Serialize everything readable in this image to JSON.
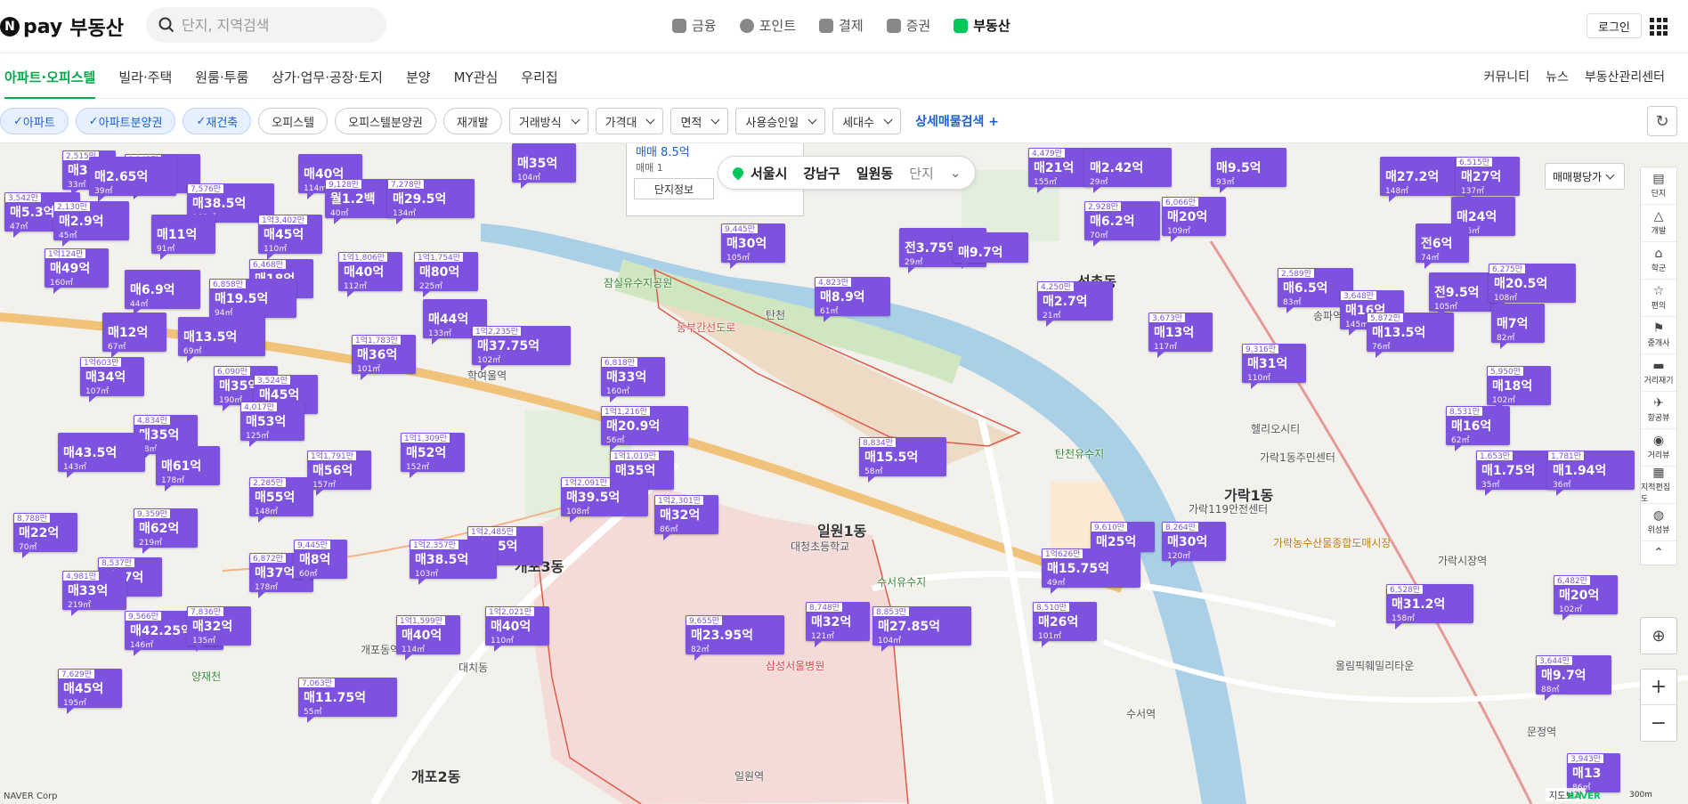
{
  "header": {
    "logo_pay": "pay",
    "logo_service": "부동산",
    "search_placeholder": "단지, 지역검색",
    "gnb": [
      {
        "label": "금융",
        "active": false
      },
      {
        "label": "포인트",
        "active": false
      },
      {
        "label": "결제",
        "active": false
      },
      {
        "label": "증권",
        "active": false
      },
      {
        "label": "부동산",
        "active": true
      }
    ],
    "login_label": "로그인"
  },
  "subnav": {
    "left": [
      "아파트·오피스텔",
      "빌라·주택",
      "원룸·투룸",
      "상가·업무·공장·토지",
      "분양",
      "MY관심",
      "우리집"
    ],
    "right": [
      "커뮤니티",
      "뉴스",
      "부동산관리센터"
    ]
  },
  "filters": {
    "selected_chips": [
      "아파트",
      "아파트분양권",
      "재건축"
    ],
    "chips": [
      "오피스텔",
      "오피스텔분양권",
      "재개발"
    ],
    "dropdowns": [
      "거래방식",
      "가격대",
      "면적",
      "사용승인일",
      "세대수"
    ],
    "advanced_label": "상세매물검색 +"
  },
  "map": {
    "breadcrumb": {
      "city": "서울시",
      "district": "강남구",
      "dong": "일원동",
      "type": "단지"
    },
    "popup": {
      "title": "매매 8.5억",
      "sub": "매매 1",
      "tab": "단지정보"
    },
    "unit_select": "매매평당가",
    "tools": [
      {
        "label": "단지",
        "glyph": "▤"
      },
      {
        "label": "개발",
        "glyph": "△"
      },
      {
        "label": "학군",
        "glyph": "⌂"
      },
      {
        "label": "편의",
        "glyph": "☆"
      },
      {
        "label": "중개사",
        "glyph": "⚑"
      },
      {
        "label": "거리재기",
        "glyph": "▬"
      },
      {
        "label": "항공뷰",
        "glyph": "✈"
      },
      {
        "label": "거리뷰",
        "glyph": "◉"
      },
      {
        "label": "지적편집도",
        "glyph": "▦"
      },
      {
        "label": "위성뷰",
        "glyph": "◍"
      }
    ],
    "copyright": "NAVER Corp",
    "scale_label": "지도보기",
    "naver_tag": "NAVER",
    "scale_bar": "300m",
    "places": [
      {
        "name": "석촌동",
        "big": true
      },
      {
        "name": "가락1동",
        "big": true
      },
      {
        "name": "일원1동",
        "big": true
      },
      {
        "name": "개포3동",
        "big": true
      },
      {
        "name": "개포2동",
        "big": true
      },
      {
        "name": "탄천",
        "big": false
      },
      {
        "name": "학여울역",
        "big": false
      },
      {
        "name": "송파역",
        "big": false
      },
      {
        "name": "가락시장역",
        "big": false
      },
      {
        "name": "수서역",
        "big": false
      },
      {
        "name": "문정역",
        "big": false
      },
      {
        "name": "일원역",
        "big": false
      },
      {
        "name": "개포동역",
        "big": false
      },
      {
        "name": "양재천",
        "big": false
      },
      {
        "name": "삼성서울병원",
        "big": false
      },
      {
        "name": "대청초등학교",
        "big": false
      },
      {
        "name": "수서유수지",
        "big": false
      },
      {
        "name": "탄천유수지",
        "big": false
      },
      {
        "name": "동부간선도로",
        "big": false
      },
      {
        "name": "잠실유수지공원",
        "big": false
      },
      {
        "name": "헬리오시티",
        "big": false
      },
      {
        "name": "가락1동주민센터",
        "big": false
      },
      {
        "name": "가락119안전센터",
        "big": false
      },
      {
        "name": "올림픽훼밀리타운",
        "big": false
      },
      {
        "name": "대치동",
        "big": false
      },
      {
        "name": "가락농수산물종합도매시장",
        "big": false
      }
    ],
    "markers": [
      {
        "cnt": "2,515만",
        "price": "매3",
        "area": "33㎡"
      },
      {
        "cnt": "3,165만",
        "price": "매4.5억",
        "area": "47㎡"
      },
      {
        "cnt": "",
        "price": "매40억",
        "area": "114㎡"
      },
      {
        "cnt": "",
        "price": "매35억",
        "area": "104㎡"
      },
      {
        "cnt": "",
        "price": "매2.65억",
        "area": "39㎡"
      },
      {
        "cnt": "3,542만",
        "price": "매5.3억",
        "area": "47㎡"
      },
      {
        "cnt": "9,128만",
        "price": "월1.2백",
        "area": "40㎡"
      },
      {
        "cnt": "7,278만",
        "price": "매29.5억",
        "area": "134㎡"
      },
      {
        "cnt": "7,576만",
        "price": "매38.5억",
        "area": "168㎡"
      },
      {
        "cnt": "2,130만",
        "price": "매2.9억",
        "area": "45㎡"
      },
      {
        "cnt": "",
        "price": "매11억",
        "area": "91㎡"
      },
      {
        "cnt": "1억3,402만",
        "price": "매45억",
        "area": "110㎡"
      },
      {
        "cnt": "1억124만",
        "price": "매49억",
        "area": "160㎡"
      },
      {
        "cnt": "6,468만",
        "price": "매18억",
        "area": "91㎡"
      },
      {
        "cnt": "1억1,806만",
        "price": "매40억",
        "area": "112㎡"
      },
      {
        "cnt": "1억1,754만",
        "price": "매80억",
        "area": "225㎡"
      },
      {
        "cnt": "",
        "price": "매6.9억",
        "area": "44㎡"
      },
      {
        "cnt": "6,858만",
        "price": "매19.5억",
        "area": "94㎡"
      },
      {
        "cnt": "",
        "price": "매44억",
        "area": "133㎡"
      },
      {
        "cnt": "",
        "price": "매12억",
        "area": "67㎡"
      },
      {
        "cnt": "",
        "price": "매13.5억",
        "area": "69㎡"
      },
      {
        "cnt": "1억2,235만",
        "price": "매37.75억",
        "area": "102㎡"
      },
      {
        "cnt": "1억1,783만",
        "price": "매36억",
        "area": "101㎡"
      },
      {
        "cnt": "1억603만",
        "price": "매34억",
        "area": "107㎡"
      },
      {
        "cnt": "6,090만",
        "price": "매35억",
        "area": "190㎡"
      },
      {
        "cnt": "3,524만",
        "price": "매45억",
        "area": "127㎡"
      },
      {
        "cnt": "4,834만",
        "price": "매35억",
        "area": "78㎡"
      },
      {
        "cnt": "4,017만",
        "price": "매53억",
        "area": "125㎡"
      },
      {
        "cnt": "",
        "price": "매43.5억",
        "area": "143㎡"
      },
      {
        "cnt": "",
        "price": "매61억",
        "area": "178㎡"
      },
      {
        "cnt": "1억1,309만",
        "price": "매52억",
        "area": "152㎡"
      },
      {
        "cnt": "1억1,791만",
        "price": "매56억",
        "area": "157㎡"
      },
      {
        "cnt": "2,285만",
        "price": "매55억",
        "area": "148㎡"
      },
      {
        "cnt": "6,818만",
        "price": "매33억",
        "area": "160㎡"
      },
      {
        "cnt": "1억1,216만",
        "price": "매20.9억",
        "area": "56㎡"
      },
      {
        "cnt": "1억1,019만",
        "price": "매35억",
        "area": "105㎡"
      },
      {
        "cnt": "1억2,091만",
        "price": "매39.5억",
        "area": "108㎡"
      },
      {
        "cnt": "1억2,301만",
        "price": "매32억",
        "area": "86㎡"
      },
      {
        "cnt": "1억2,485만",
        "price": "매5.5억",
        "area": "39㎡"
      },
      {
        "cnt": "8,788만",
        "price": "매22억",
        "area": "70㎡"
      },
      {
        "cnt": "9,359만",
        "price": "매62억",
        "area": "219㎡"
      },
      {
        "cnt": "8,537만",
        "price": "매47억",
        "area": "182㎡"
      },
      {
        "cnt": "4,981만",
        "price": "매33억",
        "area": "219㎡"
      },
      {
        "cnt": "6,872만",
        "price": "매37억",
        "area": "178㎡"
      },
      {
        "cnt": "9,445만",
        "price": "매8억",
        "area": "60㎡"
      },
      {
        "cnt": "1억2,357만",
        "price": "매38.5억",
        "area": "103㎡"
      },
      {
        "cnt": "9,566만",
        "price": "매42.25억",
        "area": "146㎡"
      },
      {
        "cnt": "7,836만",
        "price": "매32억",
        "area": "135㎡"
      },
      {
        "cnt": "1억1,599만",
        "price": "매40억",
        "area": "114㎡"
      },
      {
        "cnt": "1억2,021만",
        "price": "매40억",
        "area": "110㎡"
      },
      {
        "cnt": "7,629만",
        "price": "매45억",
        "area": "195㎡"
      },
      {
        "cnt": "7,063만",
        "price": "매11.75억",
        "area": "55㎡"
      },
      {
        "cnt": "9,655만",
        "price": "매23.95억",
        "area": "82㎡"
      },
      {
        "cnt": "8,748만",
        "price": "매32억",
        "area": "121㎡"
      },
      {
        "cnt": "8,853만",
        "price": "매27.85억",
        "area": "104㎡"
      },
      {
        "cnt": "8,834만",
        "price": "매15.5억",
        "area": "58㎡"
      },
      {
        "cnt": "9,445만",
        "price": "매30억",
        "area": "105㎡"
      },
      {
        "cnt": "4,823만",
        "price": "매8.9억",
        "area": "61㎡"
      },
      {
        "cnt": "",
        "price": "전3.75억",
        "area": "29㎡"
      },
      {
        "cnt": "",
        "price": "매9.7억",
        "area": ""
      },
      {
        "cnt": "4,250만",
        "price": "매2.7억",
        "area": "21㎡"
      },
      {
        "cnt": "4,479만",
        "price": "매21억",
        "area": "155㎡"
      },
      {
        "cnt": "",
        "price": "매2.42억",
        "area": "29㎡"
      },
      {
        "cnt": "2,928만",
        "price": "매6.2억",
        "area": "70㎡"
      },
      {
        "cnt": "6,066만",
        "price": "매20억",
        "area": "109㎡"
      },
      {
        "cnt": "",
        "price": "매9.5억",
        "area": "93㎡"
      },
      {
        "cnt": "3,673만",
        "price": "매13억",
        "area": "117㎡"
      },
      {
        "cnt": "9,316만",
        "price": "매31억",
        "area": "110㎡"
      },
      {
        "cnt": "9,610만",
        "price": "매25억",
        "area": ""
      },
      {
        "cnt": "8,264만",
        "price": "매30억",
        "area": "120㎡"
      },
      {
        "cnt": "1억626만",
        "price": "매15.75억",
        "area": "49㎡"
      },
      {
        "cnt": "8,510만",
        "price": "매26억",
        "area": "101㎡"
      },
      {
        "cnt": "2,589만",
        "price": "매6.5억",
        "area": "83㎡"
      },
      {
        "cnt": "3,648만",
        "price": "매16억",
        "area": "145㎡"
      },
      {
        "cnt": "5,872만",
        "price": "매13.5억",
        "area": "76㎡"
      },
      {
        "cnt": "",
        "price": "매27.2억",
        "area": "148㎡"
      },
      {
        "cnt": "6,515만",
        "price": "매27억",
        "area": "137㎡"
      },
      {
        "cnt": "",
        "price": "매24억",
        "area": "105㎡"
      },
      {
        "cnt": "",
        "price": "전6억",
        "area": "74㎡"
      },
      {
        "cnt": "",
        "price": "전9.5억",
        "area": "105㎡"
      },
      {
        "cnt": "6,275만",
        "price": "매20.5억",
        "area": "108㎡"
      },
      {
        "cnt": "",
        "price": "매7억",
        "area": "82㎡"
      },
      {
        "cnt": "5,950만",
        "price": "매18억",
        "area": "102㎡"
      },
      {
        "cnt": "8,531만",
        "price": "매16억",
        "area": "62㎡"
      },
      {
        "cnt": "1,653만",
        "price": "매1.75억",
        "area": "35㎡"
      },
      {
        "cnt": "1,781만",
        "price": "매1.94억",
        "area": "36㎡"
      },
      {
        "cnt": "6,482만",
        "price": "매20억",
        "area": "102㎡"
      },
      {
        "cnt": "6,528만",
        "price": "매31.2억",
        "area": "158㎡"
      },
      {
        "cnt": "3,644만",
        "price": "매9.7억",
        "area": "88㎡"
      },
      {
        "cnt": "3,943만",
        "price": "매13",
        "area": "86㎡"
      }
    ]
  }
}
